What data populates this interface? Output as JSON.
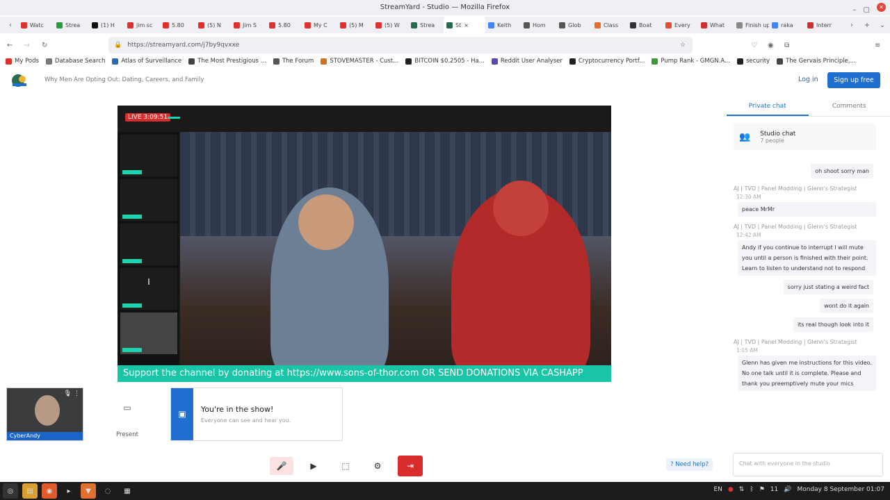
{
  "window": {
    "title": "StreamYard - Studio — Mozilla Firefox"
  },
  "tabs": [
    {
      "label": "Watc",
      "color": "#e03030"
    },
    {
      "label": "Strea",
      "color": "#2a9d3a"
    },
    {
      "label": "(1) H",
      "color": "#111111"
    },
    {
      "label": "jim sc",
      "color": "#e03030"
    },
    {
      "label": "5.80",
      "color": "#e03030"
    },
    {
      "label": "(5) N",
      "color": "#e03030"
    },
    {
      "label": "Jim S",
      "color": "#e03030"
    },
    {
      "label": "5.80",
      "color": "#e03030"
    },
    {
      "label": "My C",
      "color": "#e03030"
    },
    {
      "label": "(5) M",
      "color": "#e03030"
    },
    {
      "label": "(5) W",
      "color": "#e03030"
    },
    {
      "label": "Strea",
      "color": "#2a6a50"
    },
    {
      "label": "St",
      "color": "#2a6a50",
      "active": true
    },
    {
      "label": "Keith",
      "color": "#4285f4"
    },
    {
      "label": "Hom",
      "color": "#555555"
    },
    {
      "label": "Glob",
      "color": "#555555"
    },
    {
      "label": "Class",
      "color": "#e07030"
    },
    {
      "label": "Boat",
      "color": "#333333"
    },
    {
      "label": "Every",
      "color": "#e05030"
    },
    {
      "label": "What",
      "color": "#d03030"
    },
    {
      "label": "Finish up",
      "color": "#888888"
    },
    {
      "label": "raka",
      "color": "#4285f4"
    },
    {
      "label": "Interr",
      "color": "#d03030"
    }
  ],
  "url": "https://streamyard.com/j7by9qvxxe",
  "bookmarks": [
    {
      "label": "My Pods",
      "color": "#e03030"
    },
    {
      "label": "Database Search",
      "color": "#777777"
    },
    {
      "label": "Atlas of Surveillance",
      "color": "#2a6ab0"
    },
    {
      "label": "The Most Prestigious ...",
      "color": "#444444"
    },
    {
      "label": "The Forum",
      "color": "#555555"
    },
    {
      "label": "STOVEMASTER - Cust...",
      "color": "#d07020"
    },
    {
      "label": "BITCOIN $0.2505 - Ha...",
      "color": "#222222"
    },
    {
      "label": "Reddit User Analyser",
      "color": "#5a4ab0"
    },
    {
      "label": "Cryptocurrency Portf...",
      "color": "#222222"
    },
    {
      "label": "Pump Rank - GMGN.A...",
      "color": "#3a9a3a"
    },
    {
      "label": "security",
      "color": "#222222"
    },
    {
      "label": "The Gervais Principle,...",
      "color": "#444444"
    }
  ],
  "streamyard": {
    "broadcast_title": "Why Men Are Opting Out: Dating, Careers, and Family",
    "login": "Log in",
    "signup": "Sign up free"
  },
  "stage": {
    "live": "LIVE 3:09:51",
    "ticker": "Support the channel by donating at https://www.sons-of-thor.com OR SEND DONATIONS VIA CASHAPP",
    "side_cam_letter": "I"
  },
  "self": {
    "name": "CyberAndy"
  },
  "present": {
    "label": "Present"
  },
  "toast": {
    "title": "You're in the show!",
    "subtitle": "Everyone can see and hear you."
  },
  "help": "Need help?",
  "chat": {
    "tabs": [
      "Private chat",
      "Comments"
    ],
    "room_name": "Studio chat",
    "room_count": "7 people",
    "input_placeholder": "Chat with everyone in the studio",
    "messages": [
      {
        "mine": true,
        "text": "oh shoot sorry man"
      },
      {
        "sender": "AJ | TVD | Panel Modding | Glenn's Strategist",
        "time": "12:30 AM",
        "text": "peace MrMr"
      },
      {
        "sender": "AJ | TVD | Panel Modding | Glenn's Strategist",
        "time": "12:42 AM",
        "text": "Andy if you continue to interrupt I will mute you until a person is finished with their point. Learn to listen to understand not to respond"
      },
      {
        "mine": true,
        "text": "sorry just stating a weird fact"
      },
      {
        "mine": true,
        "text": "wont do it again"
      },
      {
        "mine": true,
        "text": "its real though look into it"
      },
      {
        "sender": "AJ | TVD | Panel Modding | Glenn's Strategist",
        "time": "1:05 AM",
        "text": "Glenn has given me instructions for this video. No one talk until it is complete. Please and thank you preemptively mute your mics"
      }
    ]
  },
  "taskbar": {
    "lang": "EN",
    "volume": "11",
    "clock": "Monday  8 September 01:07"
  },
  "colors": {
    "accent": "#1f6fd1",
    "teal": "#18c5a6",
    "live": "#d62e2e"
  }
}
